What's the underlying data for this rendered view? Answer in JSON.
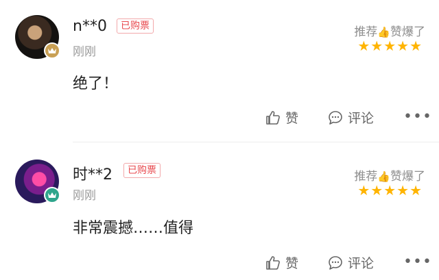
{
  "reviews": [
    {
      "username": "n**0",
      "badge": "已购票",
      "time": "刚刚",
      "recommend": "推荐",
      "recommend_icon": "thumbs-up-emoji",
      "verdict": "赞爆了",
      "rating": 5,
      "stars": "★★★★★",
      "content": "绝了！",
      "like_label": "赞",
      "comment_label": "评论",
      "more": "•••",
      "member_level": "gold"
    },
    {
      "username": "时**2",
      "badge": "已购票",
      "time": "刚刚",
      "recommend": "推荐",
      "recommend_icon": "thumbs-up-emoji",
      "verdict": "赞爆了",
      "rating": 5,
      "stars": "★★★★★",
      "content": "非常震撼……值得",
      "like_label": "赞",
      "comment_label": "评论",
      "more": "•••",
      "member_level": "green"
    }
  ],
  "colors": {
    "badge": "#e8474c",
    "star": "#ffb400",
    "crown_gold": "#c9a055",
    "crown_green": "#2fa58c"
  }
}
